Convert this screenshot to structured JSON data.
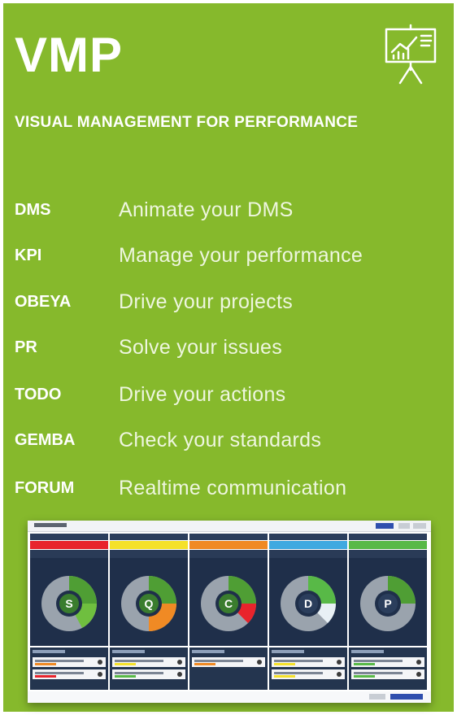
{
  "header": {
    "title": "VMP",
    "subtitle": "VISUAL MANAGEMENT FOR PERFORMANCE",
    "logo_icon": "presentation-chart-icon"
  },
  "modules": [
    {
      "code": "DMS",
      "description": "Animate your DMS"
    },
    {
      "code": "KPI",
      "description": "Manage your performance"
    },
    {
      "code": "OBEYA",
      "description": "Drive your projects"
    },
    {
      "code": "PR",
      "description": "Solve your issues"
    },
    {
      "code": "TODO",
      "description": "Drive your actions"
    },
    {
      "code": "GEMBA",
      "description": "Check your standards"
    },
    {
      "code": "FORUM",
      "description": "Realtime communication"
    }
  ],
  "screenshot": {
    "columns": [
      {
        "letter": "S",
        "bar_color": "#e8242c"
      },
      {
        "letter": "Q",
        "bar_color": "#f5e12b"
      },
      {
        "letter": "C",
        "bar_color": "#f08a24"
      },
      {
        "letter": "D",
        "bar_color": "#3fa9e0"
      },
      {
        "letter": "P",
        "bar_color": "#58b947"
      }
    ]
  },
  "colors": {
    "background": "#86b92c",
    "text": "#ffffff",
    "panel": "#1f2f4a"
  }
}
